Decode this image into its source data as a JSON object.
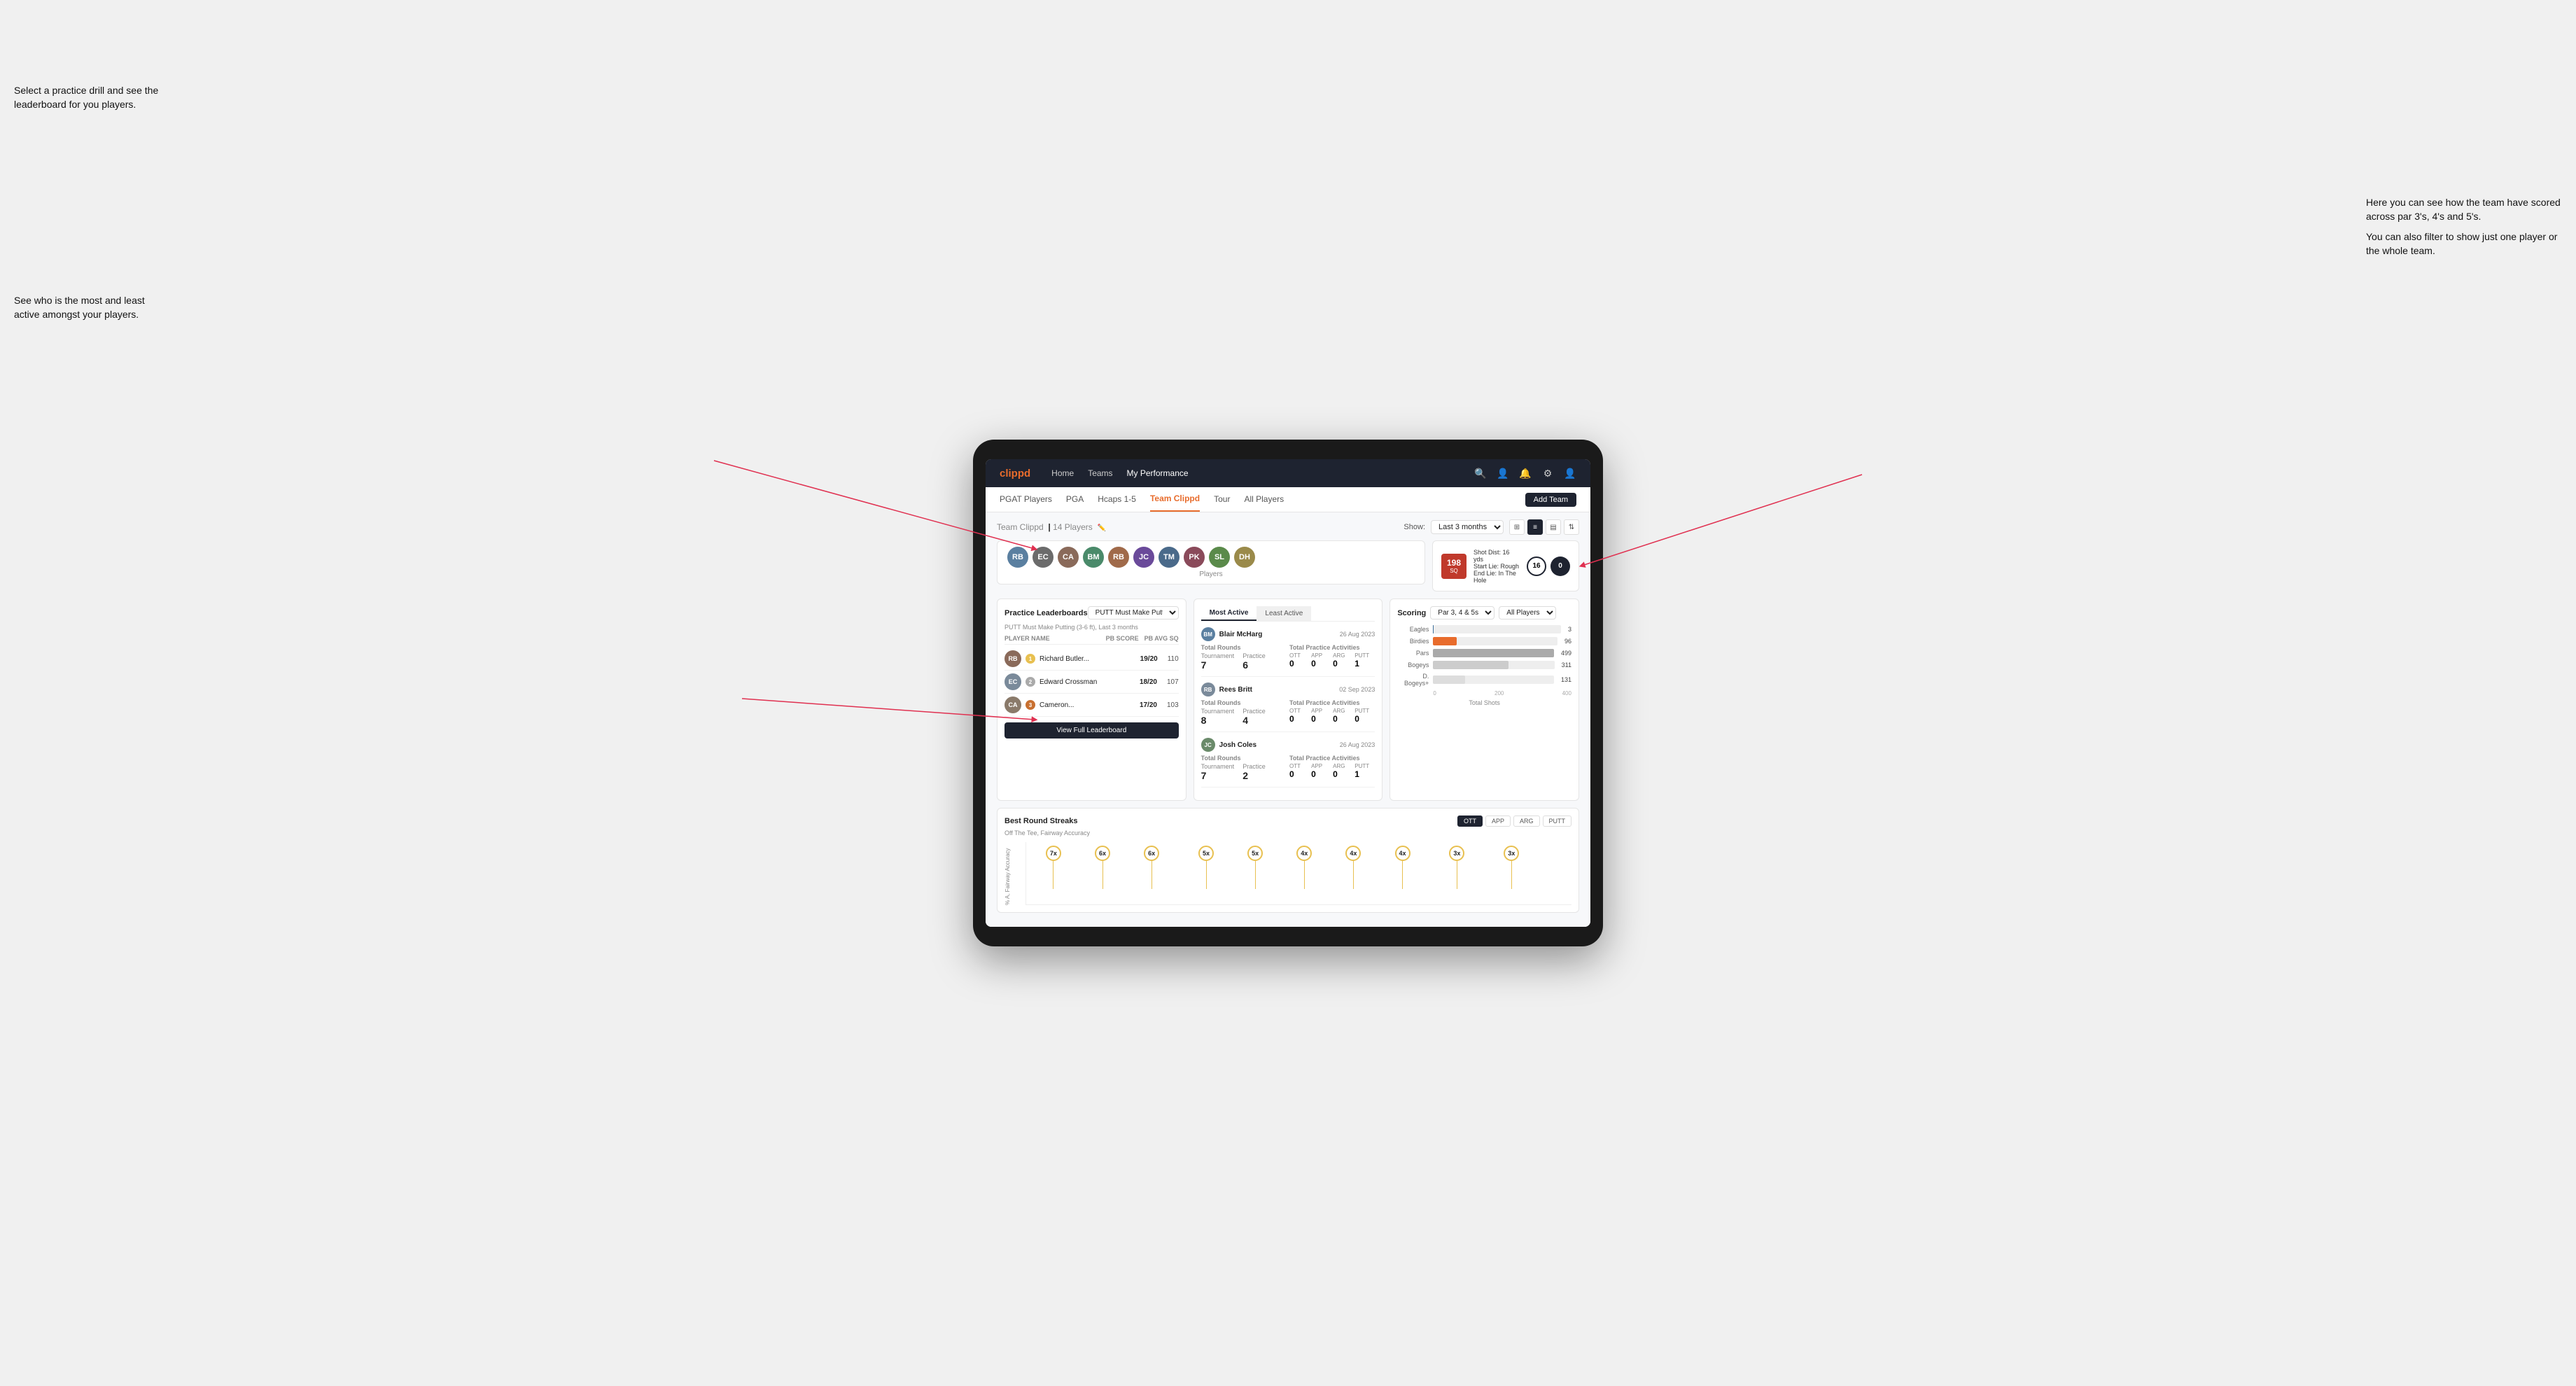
{
  "annotations": {
    "top_left": "Select a practice drill and see\nthe leaderboard for you players.",
    "bottom_left": "See who is the most and least\nactive amongst your players.",
    "top_right_title": "Here you can see how the\nteam have scored across\npar 3's, 4's and 5's.",
    "top_right_body": "You can also filter to show\njust one player or the whole\nteam."
  },
  "nav": {
    "logo": "clippd",
    "links": [
      "Home",
      "Teams",
      "My Performance"
    ],
    "icons": [
      "search",
      "users",
      "bell",
      "settings",
      "user"
    ]
  },
  "sub_nav": {
    "links": [
      "PGAT Players",
      "PGA",
      "Hcaps 1-5",
      "Team Clippd",
      "Tour",
      "All Players"
    ],
    "active": "Team Clippd",
    "add_button": "Add Team"
  },
  "team": {
    "title": "Team Clippd",
    "count": "14 Players",
    "show_label": "Show:",
    "show_value": "Last 3 months",
    "players_label": "Players"
  },
  "shot_card": {
    "distance": "198",
    "unit": "SQ",
    "dist_label": "Shot Dist: 16 yds",
    "start_lie": "Start Lie: Rough",
    "end_lie": "End Lie: In The Hole",
    "yds_left": "16",
    "yds_right": "0"
  },
  "practice_leaderboards": {
    "title": "Practice Leaderboards",
    "drill": "PUTT Must Make Putting...",
    "subtitle": "PUTT Must Make Putting (3-6 ft), Last 3 months",
    "headers": [
      "PLAYER NAME",
      "PB SCORE",
      "PB AVG SQ"
    ],
    "players": [
      {
        "name": "Richard Butler...",
        "score": "19/20",
        "avg": "110",
        "badge": "gold",
        "rank": 1
      },
      {
        "name": "Edward Crossman",
        "score": "18/20",
        "avg": "107",
        "badge": "silver",
        "rank": 2
      },
      {
        "name": "Cameron...",
        "score": "17/20",
        "avg": "103",
        "badge": "bronze",
        "rank": 3
      }
    ],
    "view_btn": "View Full Leaderboard"
  },
  "most_active": {
    "tabs": [
      "Most Active",
      "Least Active"
    ],
    "active_tab": "Most Active",
    "players": [
      {
        "name": "Blair McHarg",
        "date": "26 Aug 2023",
        "total_rounds_label": "Total Rounds",
        "tournament": "7",
        "practice": "6",
        "total_practice_label": "Total Practice Activities",
        "ott": "0",
        "app": "0",
        "arg": "0",
        "putt": "1"
      },
      {
        "name": "Rees Britt",
        "date": "02 Sep 2023",
        "total_rounds_label": "Total Rounds",
        "tournament": "8",
        "practice": "4",
        "total_practice_label": "Total Practice Activities",
        "ott": "0",
        "app": "0",
        "arg": "0",
        "putt": "0"
      },
      {
        "name": "Josh Coles",
        "date": "26 Aug 2023",
        "total_rounds_label": "Total Rounds",
        "tournament": "7",
        "practice": "2",
        "total_practice_label": "Total Practice Activities",
        "ott": "0",
        "app": "0",
        "arg": "0",
        "putt": "1"
      }
    ]
  },
  "scoring": {
    "title": "Scoring",
    "filter1": "Par 3, 4 & 5s",
    "filter2": "All Players",
    "bars": [
      {
        "label": "Eagles",
        "value": 3,
        "max": 500,
        "class": "eagles"
      },
      {
        "label": "Birdies",
        "value": 96,
        "max": 500,
        "class": "birdies"
      },
      {
        "label": "Pars",
        "value": 499,
        "max": 500,
        "class": "pars"
      },
      {
        "label": "Bogeys",
        "value": 311,
        "max": 500,
        "class": "bogeys"
      },
      {
        "label": "D. Bogeys+",
        "value": 131,
        "max": 500,
        "class": "dbogeys"
      }
    ],
    "x_labels": [
      "0",
      "200",
      "400"
    ],
    "total_shots_label": "Total Shots"
  },
  "streaks": {
    "title": "Best Round Streaks",
    "tabs": [
      "OTT",
      "APP",
      "ARG",
      "PUTT"
    ],
    "active_tab": "OTT",
    "subtitle": "Off The Tee, Fairway Accuracy",
    "dots": [
      {
        "x": 5,
        "label": "7x"
      },
      {
        "x": 13,
        "label": "6x"
      },
      {
        "x": 21,
        "label": "6x"
      },
      {
        "x": 30,
        "label": "5x"
      },
      {
        "x": 38,
        "label": "5x"
      },
      {
        "x": 47,
        "label": "4x"
      },
      {
        "x": 55,
        "label": "4x"
      },
      {
        "x": 63,
        "label": "4x"
      },
      {
        "x": 72,
        "label": "3x"
      },
      {
        "x": 80,
        "label": "3x"
      }
    ]
  },
  "colors": {
    "accent": "#e86c2c",
    "dark": "#1e2330",
    "danger": "#e03050"
  }
}
